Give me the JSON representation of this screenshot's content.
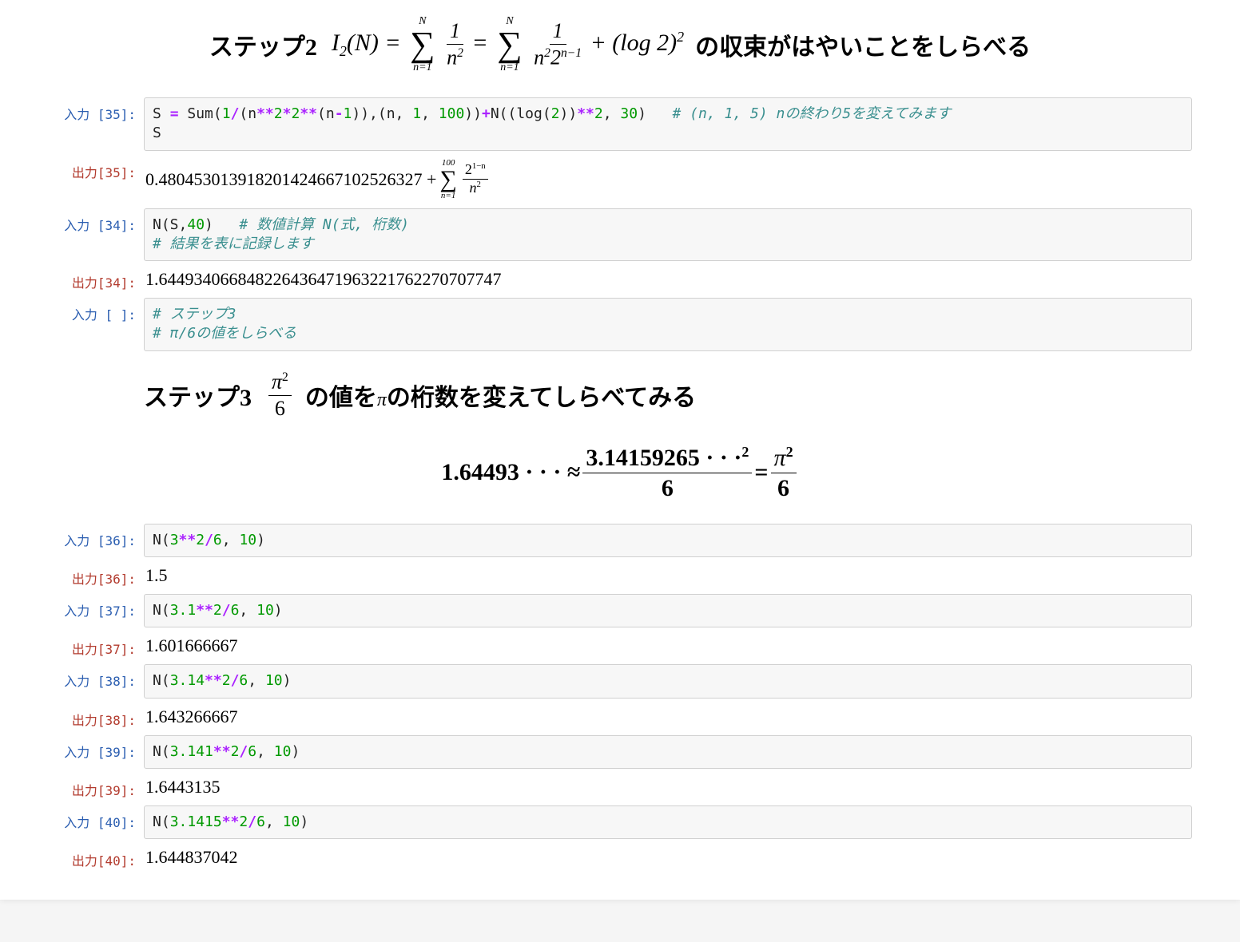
{
  "step2": {
    "label": "ステップ2",
    "tail": "の収束がはやいことをしらべる",
    "I2N": "I",
    "sub2": "2",
    "Nvar": "N",
    "eq": "=",
    "sumN_top": "N",
    "sumN_bot": "n=1",
    "frac1_num": "1",
    "frac1_den_n": "n",
    "sup2": "2",
    "frac2_num": "1",
    "frac2_den_n2": "n",
    "frac2_den_2": "2",
    "frac2_den_exp_pre": "n−1",
    "plus_log": "+ (log 2)",
    "log_sup": "2"
  },
  "cell35_in": {
    "prompt": "入力 [35]:",
    "l1_a": "S ",
    "l1_eq": "=",
    "l1_b": " Sum(",
    "l1_n1": "1",
    "l1_s1": "/",
    "l1_c": "(n",
    "l1_pp1": "**",
    "l1_n2": "2",
    "l1_star": "*",
    "l1_n2b": "2",
    "l1_pp2": "**",
    "l1_d": "(n",
    "l1_minus": "-",
    "l1_n1b": "1",
    "l1_e": ")),(n, ",
    "l1_n1c": "1",
    "l1_f": ", ",
    "l1_n100": "100",
    "l1_g": "))",
    "l1_plus": "+",
    "l1_h": "N((log(",
    "l1_n2c": "2",
    "l1_i": "))",
    "l1_pp3": "**",
    "l1_n2d": "2",
    "l1_j": ", ",
    "l1_n30": "30",
    "l1_k": ")   ",
    "l1_cm": "# (n, 1, 5) nの終わり5を変えてみます",
    "l2": "S"
  },
  "cell35_out": {
    "prompt": "出力[35]:",
    "num": "0.480453013918201424667102526327 + ",
    "sum_top": "100",
    "sum_bot": "n=1",
    "frac_num_2": "2",
    "frac_num_exp": "1−n",
    "frac_den_n": "n",
    "frac_den_sup": "2"
  },
  "cell34_in": {
    "prompt": "入力 [34]:",
    "l1_a": "N(S,",
    "l1_n": "40",
    "l1_b": ")   ",
    "l1_cm": "# 数値計算 N(式, 桁数)",
    "l2_cm": "# 結果を表に記録します"
  },
  "cell34_out": {
    "prompt": "出力[34]:",
    "value": "1.644934066848226436471963221762270707747"
  },
  "cell_blank_in": {
    "prompt": "入力 [ ]:",
    "l1_cm": "# ステップ3",
    "l2_cm": "# π/6の値をしらべる"
  },
  "step3": {
    "label": "ステップ3",
    "frac_num_pi": "π",
    "frac_num_sup": "2",
    "frac_den": "6",
    "mid": "の値を",
    "pivar": "π",
    "tail": "の桁数を変えてしらべてみる",
    "eq_left": "1.64493 · · · ≈ ",
    "eq_frac_num": "3.14159265 · · ·",
    "eq_frac_num_sup": "2",
    "eq_frac_den": "6",
    "eq_mid": " = ",
    "eq_rfrac_num_pi": "π",
    "eq_rfrac_num_sup": "2",
    "eq_rfrac_den": "6"
  },
  "pairs": [
    {
      "in_prompt": "入力 [36]:",
      "out_prompt": "出力[36]:",
      "a": "N(",
      "n1": "3",
      "pp": "**",
      "n2": "2",
      "sl": "/",
      "n3": "6",
      "c": ", ",
      "n4": "10",
      "d": ")",
      "out": "1.5"
    },
    {
      "in_prompt": "入力 [37]:",
      "out_prompt": "出力[37]:",
      "a": "N(",
      "n1": "3.1",
      "pp": "**",
      "n2": "2",
      "sl": "/",
      "n3": "6",
      "c": ", ",
      "n4": "10",
      "d": ")",
      "out": "1.601666667"
    },
    {
      "in_prompt": "入力 [38]:",
      "out_prompt": "出力[38]:",
      "a": "N(",
      "n1": "3.14",
      "pp": "**",
      "n2": "2",
      "sl": "/",
      "n3": "6",
      "c": ", ",
      "n4": "10",
      "d": ")",
      "out": "1.643266667"
    },
    {
      "in_prompt": "入力 [39]:",
      "out_prompt": "出力[39]:",
      "a": "N(",
      "n1": "3.141",
      "pp": "**",
      "n2": "2",
      "sl": "/",
      "n3": "6",
      "c": ", ",
      "n4": "10",
      "d": ")",
      "out": "1.6443135"
    },
    {
      "in_prompt": "入力 [40]:",
      "out_prompt": "出力[40]:",
      "a": "N(",
      "n1": "3.1415",
      "pp": "**",
      "n2": "2",
      "sl": "/",
      "n3": "6",
      "c": ", ",
      "n4": "10",
      "d": ")",
      "out": "1.644837042"
    }
  ]
}
